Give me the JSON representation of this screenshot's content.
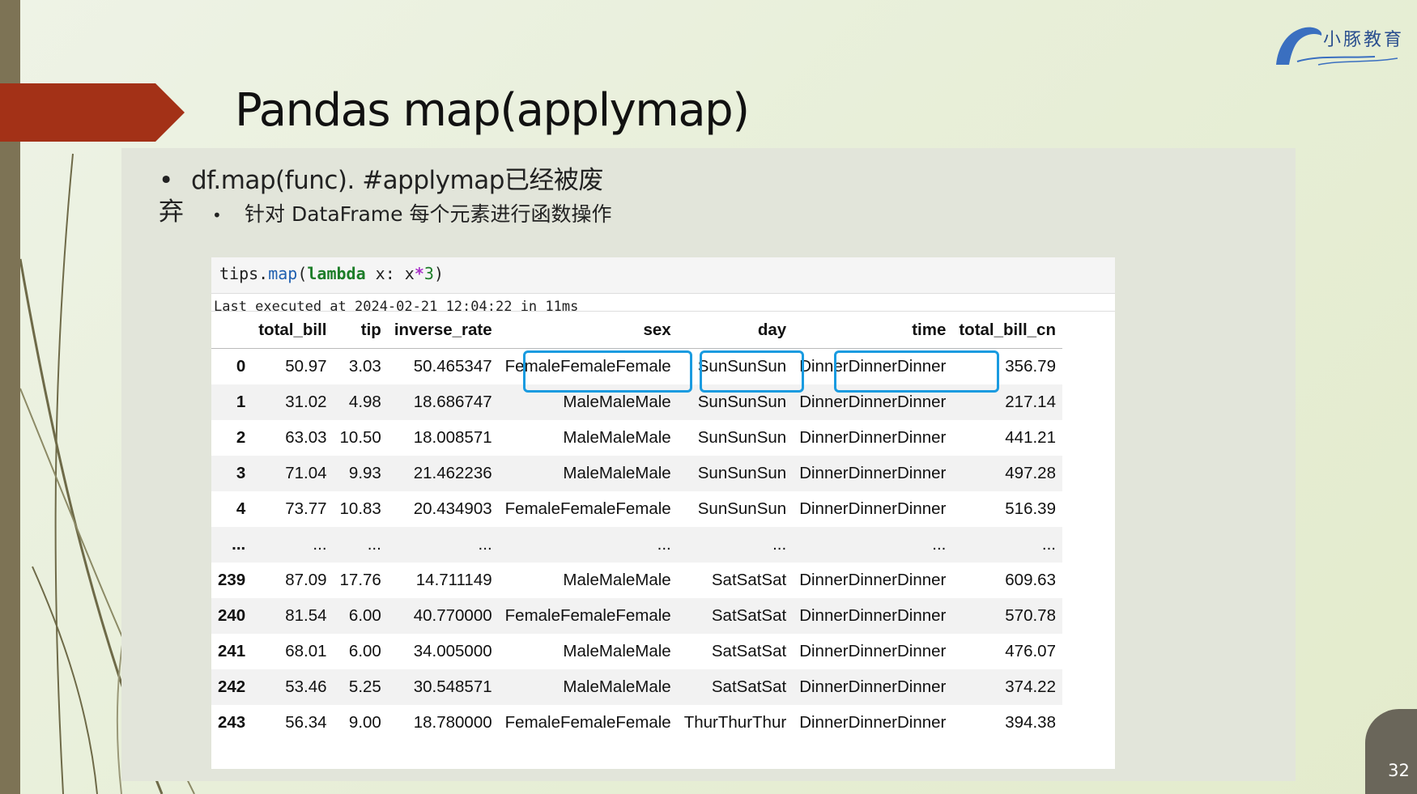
{
  "slide": {
    "title": "Pandas map(applymap)",
    "bullet1_main": "df.map(func). #applymap已经被废",
    "bullet1_wrap": "弃",
    "bullet2": "针对 DataFrame 每个元素进行函数操作",
    "bullet_symbol": "•",
    "logo_text": "小豚教育",
    "page_number": "32"
  },
  "notebook": {
    "code_parts": {
      "obj": "tips",
      "dot": ".",
      "method": "map",
      "open": "(",
      "kw": "lambda",
      "arg": " x: x",
      "op": "*",
      "num": "3",
      "close": ")"
    },
    "exec_info": "Last executed at 2024-02-21 12:04:22 in 11ms",
    "columns": [
      "",
      "total_bill",
      "tip",
      "inverse_rate",
      "sex",
      "day",
      "time",
      "total_bill_cn"
    ],
    "rows": [
      [
        "0",
        "50.97",
        "3.03",
        "50.465347",
        "FemaleFemaleFemale",
        "SunSunSun",
        "DinnerDinnerDinner",
        "356.79"
      ],
      [
        "1",
        "31.02",
        "4.98",
        "18.686747",
        "MaleMaleMale",
        "SunSunSun",
        "DinnerDinnerDinner",
        "217.14"
      ],
      [
        "2",
        "63.03",
        "10.50",
        "18.008571",
        "MaleMaleMale",
        "SunSunSun",
        "DinnerDinnerDinner",
        "441.21"
      ],
      [
        "3",
        "71.04",
        "9.93",
        "21.462236",
        "MaleMaleMale",
        "SunSunSun",
        "DinnerDinnerDinner",
        "497.28"
      ],
      [
        "4",
        "73.77",
        "10.83",
        "20.434903",
        "FemaleFemaleFemale",
        "SunSunSun",
        "DinnerDinnerDinner",
        "516.39"
      ],
      [
        "...",
        "...",
        "...",
        "...",
        "...",
        "...",
        "...",
        "..."
      ],
      [
        "239",
        "87.09",
        "17.76",
        "14.711149",
        "MaleMaleMale",
        "SatSatSat",
        "DinnerDinnerDinner",
        "609.63"
      ],
      [
        "240",
        "81.54",
        "6.00",
        "40.770000",
        "FemaleFemaleFemale",
        "SatSatSat",
        "DinnerDinnerDinner",
        "570.78"
      ],
      [
        "241",
        "68.01",
        "6.00",
        "34.005000",
        "MaleMaleMale",
        "SatSatSat",
        "DinnerDinnerDinner",
        "476.07"
      ],
      [
        "242",
        "53.46",
        "5.25",
        "30.548571",
        "MaleMaleMale",
        "SatSatSat",
        "DinnerDinnerDinner",
        "374.22"
      ],
      [
        "243",
        "56.34",
        "9.00",
        "18.780000",
        "FemaleFemaleFemale",
        "ThurThurThur",
        "DinnerDinnerDinner",
        "394.38"
      ]
    ],
    "highlight_color": "#1a9be0"
  },
  "colors": {
    "accent_red": "#a33117",
    "left_bar": "#7d7355",
    "panel": "#e2e5da"
  }
}
